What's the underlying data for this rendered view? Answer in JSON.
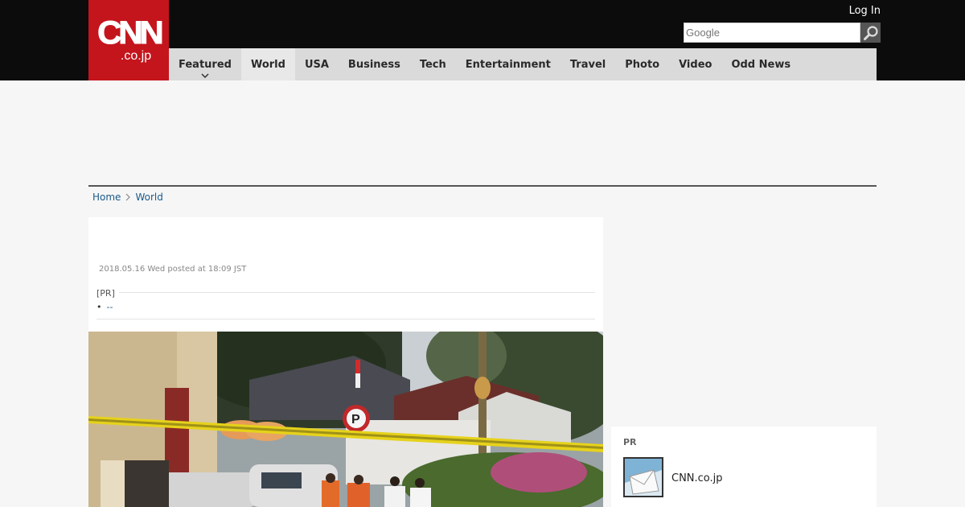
{
  "header": {
    "logo_main": "CNN",
    "logo_sub": ".co.jp",
    "login_label": "Log In",
    "search_placeholder": "Google"
  },
  "nav": {
    "items": [
      {
        "label": "Featured"
      },
      {
        "label": "World"
      },
      {
        "label": "USA"
      },
      {
        "label": "Business"
      },
      {
        "label": "Tech"
      },
      {
        "label": "Entertainment"
      },
      {
        "label": "Travel"
      },
      {
        "label": "Photo"
      },
      {
        "label": "Video"
      },
      {
        "label": "Odd News"
      }
    ],
    "active_index": 1
  },
  "breadcrumb": {
    "home": "Home",
    "section": "World"
  },
  "article": {
    "date": "2018.05.16 Wed posted at 18:09 JST",
    "pr_label": "[PR]",
    "pr_link": "--"
  },
  "sidebar": {
    "pr_title": "PR",
    "link_label": "CNN.co.jp"
  },
  "colors": {
    "brand_red": "#c4151c",
    "header_bg": "#0c0c0c",
    "nav_bg": "#dadada",
    "link": "#1a5a8a"
  }
}
